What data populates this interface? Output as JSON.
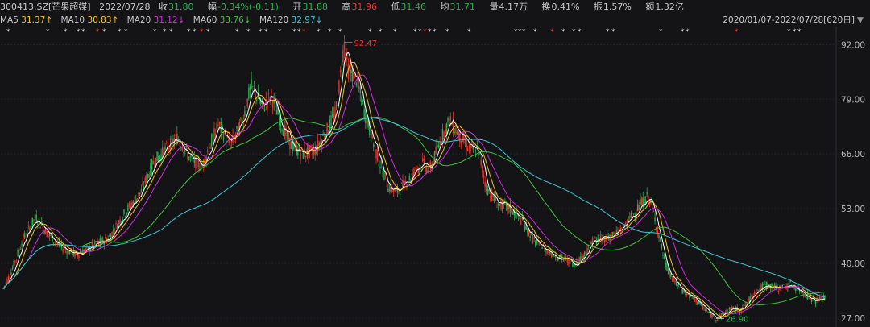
{
  "header": {
    "code": "300413.SZ[芒果超媒]",
    "date": "2022/07/28",
    "close_label": "收",
    "close_value": "31.80",
    "change_label": "幅",
    "change_value": "-0.34%(-0.11)",
    "open_label": "开",
    "open_value": "31.88",
    "high_label": "高",
    "high_value": "31.96",
    "low_label": "低",
    "low_value": "31.46",
    "avg_label": "均",
    "avg_value": "31.71",
    "volume_label": "量",
    "volume_value": "4.17万",
    "turnover_label": "换",
    "turnover_value": "0.41%",
    "amplitude_label": "振",
    "amplitude_value": "1.57%",
    "amount_label": "额",
    "amount_value": "1.32亿"
  },
  "ma_legend": [
    {
      "name": "MA5",
      "value": "31.37↑",
      "color": "#ffffff"
    },
    {
      "name": "MA10",
      "value": "30.83↑",
      "color": "#f2c21b"
    },
    {
      "name": "MA20",
      "value": "31.12↓",
      "color": "#d12cd8"
    },
    {
      "name": "MA60",
      "value": "33.76↓",
      "color": "#3fc23a"
    },
    {
      "name": "MA120",
      "value": "32.97↓",
      "color": "#37c7d6"
    }
  ],
  "range_label": "2020/01/07-2022/07/28[620日]",
  "colors": {
    "background": "#141417",
    "up": "#e8342b",
    "down": "#27b04f",
    "grid": "#2a2a30",
    "ma5": "#ffffff",
    "ma10": "#f2c21b",
    "ma20": "#d12cd8",
    "ma60": "#3fc23a",
    "ma120": "#37c7d6"
  },
  "chart_data": {
    "type": "candlestick",
    "ylim": [
      26.0,
      94.0
    ],
    "y_ticks": [
      "92.00",
      "79.00",
      "66.00",
      "53.00",
      "40.00",
      "27.00"
    ],
    "max_annotation": "92.47",
    "min_annotation": "26.90",
    "price_anchors": [
      [
        0,
        34
      ],
      [
        10,
        38
      ],
      [
        25,
        46
      ],
      [
        40,
        51
      ],
      [
        55,
        47
      ],
      [
        70,
        44
      ],
      [
        90,
        42
      ],
      [
        110,
        44
      ],
      [
        130,
        46
      ],
      [
        150,
        52
      ],
      [
        170,
        57
      ],
      [
        185,
        64
      ],
      [
        200,
        67
      ],
      [
        215,
        70
      ],
      [
        230,
        65
      ],
      [
        245,
        63
      ],
      [
        265,
        73
      ],
      [
        280,
        68
      ],
      [
        295,
        74
      ],
      [
        305,
        82
      ],
      [
        320,
        77
      ],
      [
        330,
        80
      ],
      [
        345,
        72
      ],
      [
        355,
        68
      ],
      [
        370,
        66
      ],
      [
        385,
        67
      ],
      [
        400,
        72
      ],
      [
        410,
        76
      ],
      [
        420,
        92.47
      ],
      [
        425,
        86
      ],
      [
        435,
        84
      ],
      [
        445,
        76
      ],
      [
        460,
        66
      ],
      [
        475,
        58
      ],
      [
        485,
        57
      ],
      [
        500,
        60
      ],
      [
        515,
        64
      ],
      [
        525,
        62
      ],
      [
        540,
        70
      ],
      [
        550,
        74
      ],
      [
        560,
        71
      ],
      [
        575,
        67
      ],
      [
        585,
        67
      ],
      [
        595,
        58
      ],
      [
        610,
        54
      ],
      [
        625,
        53
      ],
      [
        640,
        50
      ],
      [
        655,
        45
      ],
      [
        670,
        43
      ],
      [
        690,
        41
      ],
      [
        705,
        40
      ],
      [
        715,
        42
      ],
      [
        725,
        45
      ],
      [
        740,
        46
      ],
      [
        755,
        47
      ],
      [
        770,
        50
      ],
      [
        785,
        54
      ],
      [
        795,
        56
      ],
      [
        805,
        49
      ],
      [
        815,
        40
      ],
      [
        825,
        36
      ],
      [
        840,
        33
      ],
      [
        855,
        31
      ],
      [
        870,
        28
      ],
      [
        880,
        26.9
      ],
      [
        895,
        29
      ],
      [
        910,
        29
      ],
      [
        925,
        33
      ],
      [
        940,
        35
      ],
      [
        955,
        34
      ],
      [
        970,
        35
      ],
      [
        985,
        33
      ],
      [
        1000,
        31
      ],
      [
        1012,
        31.8
      ]
    ],
    "high_low_marker_rows": "*"
  }
}
